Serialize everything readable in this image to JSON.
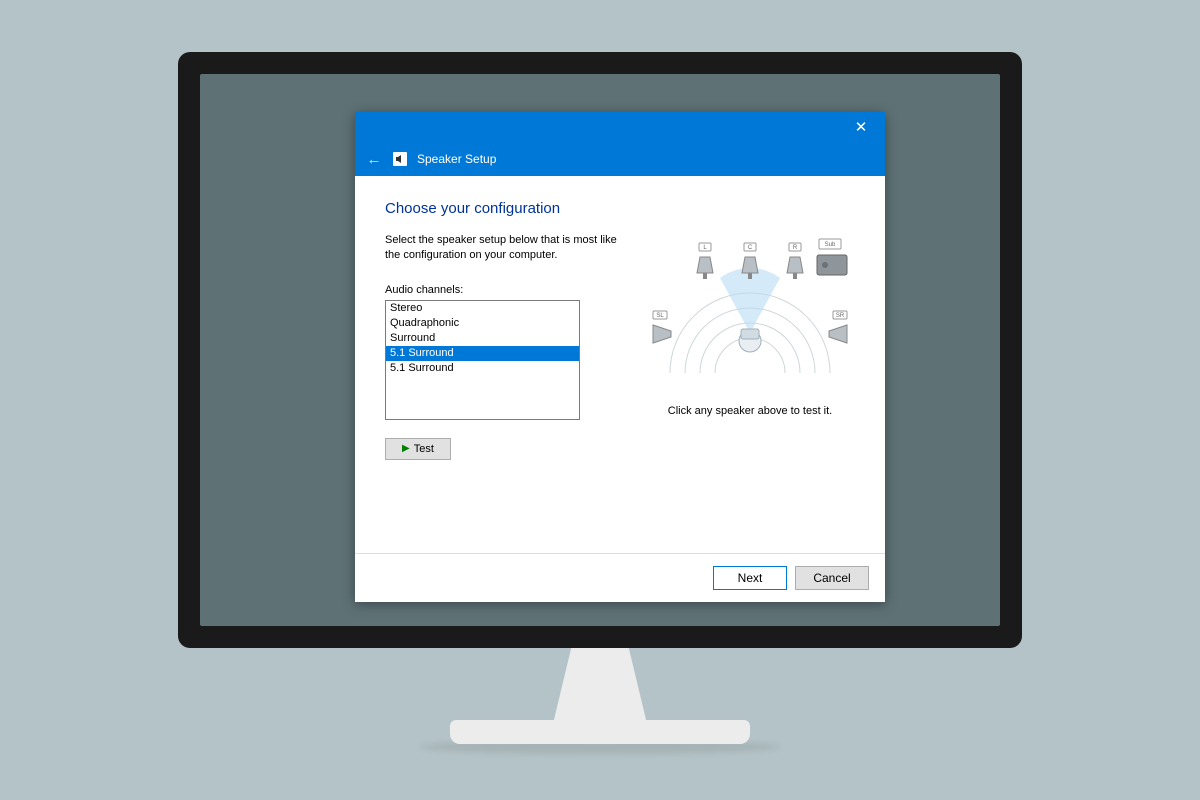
{
  "window": {
    "title": "Speaker Setup"
  },
  "content": {
    "heading": "Choose your configuration",
    "instruction": "Select the speaker setup below that is most like the configuration on your computer.",
    "list_label": "Audio channels:",
    "channels": [
      "Stereo",
      "Quadraphonic",
      "Surround",
      "5.1 Surround",
      "5.1 Surround"
    ],
    "selected_index": 3,
    "test_label": "Test",
    "hint": "Click any speaker above to test it."
  },
  "diagram": {
    "speakers": [
      "L",
      "C",
      "R",
      "Sub",
      "SL",
      "SR"
    ]
  },
  "footer": {
    "next": "Next",
    "cancel": "Cancel"
  }
}
